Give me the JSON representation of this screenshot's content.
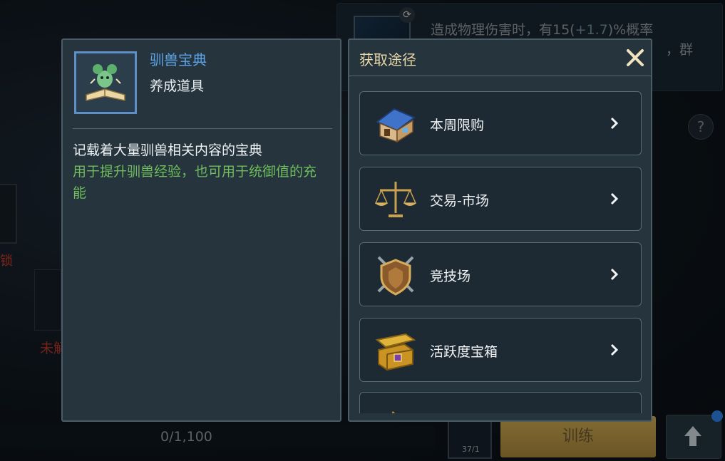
{
  "background": {
    "skill_description_line1": "造成物理伤害时，有15(",
    "skill_description_bonus": "+1.7",
    "skill_description_line1_end": ")%概率",
    "skill_description_line2": "，群",
    "help_symbol": "?",
    "locked_text": "锁",
    "unlocked_text": "未解",
    "progress_text": "0/1,100",
    "item_count_text": "37/1",
    "train_button_label": "训练"
  },
  "item_panel": {
    "name": "驯兽宝典",
    "type": "养成道具",
    "description": "记载着大量驯兽相关内容的宝典",
    "usage": "用于提升驯兽经验，也可用于统御值的充能",
    "icon": "beast-tome-icon"
  },
  "source_panel": {
    "title": "获取途径",
    "close_icon": "close-icon",
    "items": [
      {
        "label": "本周限购",
        "icon": "shop-house-icon"
      },
      {
        "label": "交易-市场",
        "icon": "scales-icon"
      },
      {
        "label": "竞技场",
        "icon": "shield-swords-icon"
      },
      {
        "label": "活跃度宝箱",
        "icon": "treasure-chest-icon"
      },
      {
        "label": "",
        "icon": "partial-item-icon"
      }
    ]
  },
  "colors": {
    "item_name": "#5ea4e8",
    "usage_text": "#6fbd5d",
    "panel_title": "#e9d8a8",
    "panel_bg": "#25343d"
  }
}
